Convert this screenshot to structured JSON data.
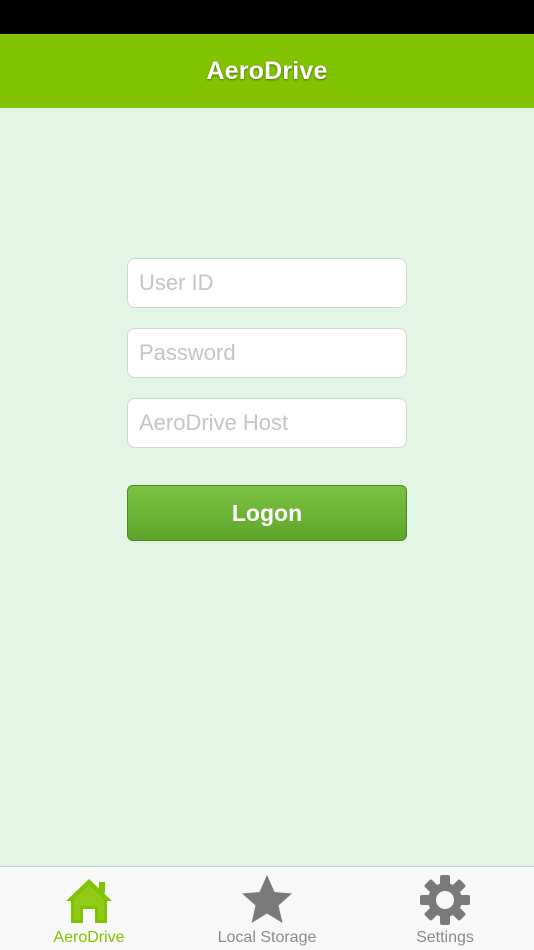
{
  "header": {
    "title": "AeroDrive"
  },
  "form": {
    "user_id": {
      "value": "",
      "placeholder": "User ID"
    },
    "password": {
      "value": "",
      "placeholder": "Password"
    },
    "host": {
      "value": "",
      "placeholder": "AeroDrive Host"
    },
    "logon_label": "Logon"
  },
  "tabs": [
    {
      "label": "AeroDrive",
      "icon": "home-icon",
      "active": true
    },
    {
      "label": "Local Storage",
      "icon": "star-icon",
      "active": false
    },
    {
      "label": "Settings",
      "icon": "gear-icon",
      "active": false
    }
  ],
  "colors": {
    "accent": "#82c300",
    "background": "#e3f6e5",
    "button": "#6bb436",
    "inactive_icon": "#7a7a7a"
  }
}
